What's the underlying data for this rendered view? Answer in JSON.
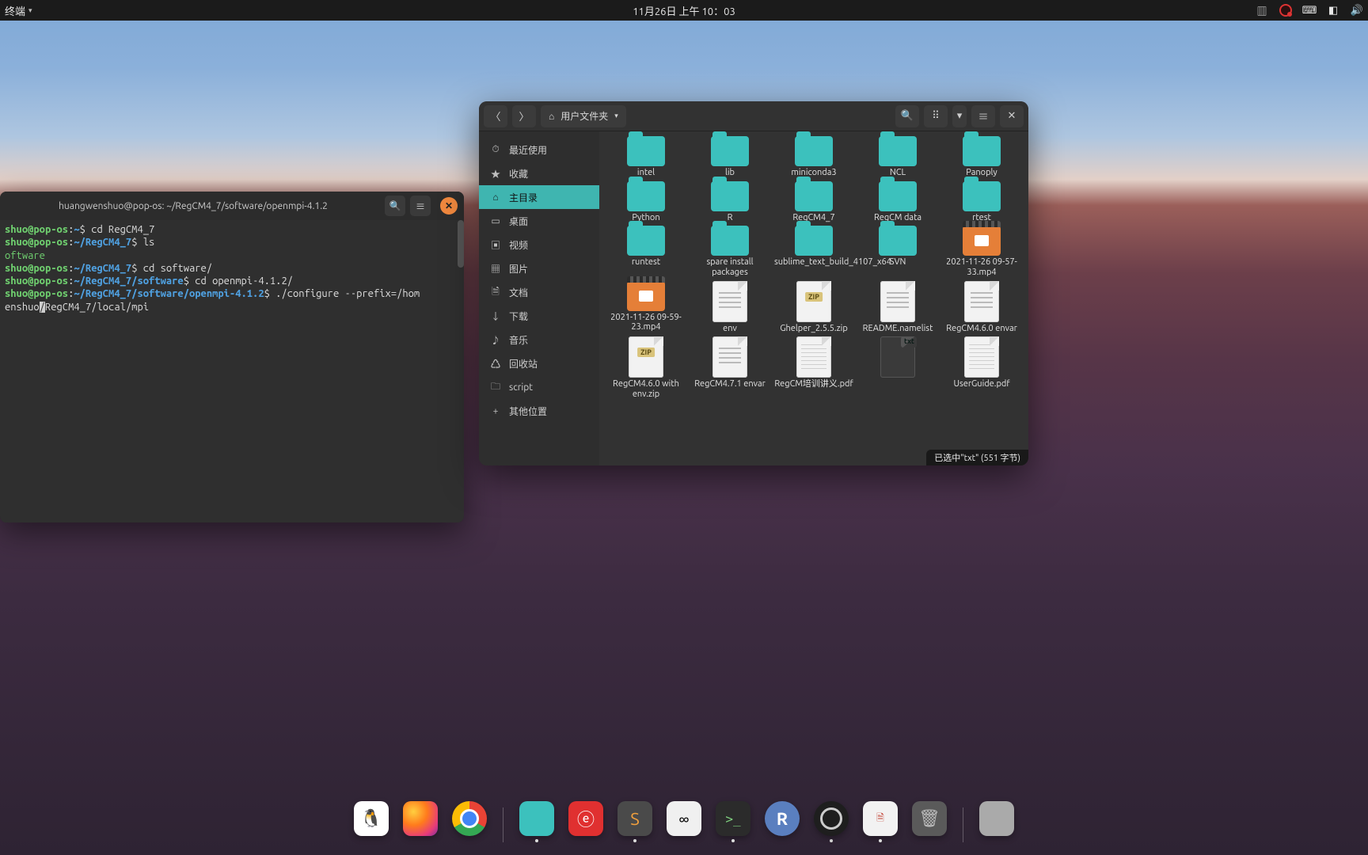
{
  "topbar": {
    "app_menu": "终端",
    "datetime": "11月26日 上午 10：03"
  },
  "terminal": {
    "title": "huangwenshuo@pop-os: ~/RegCM4_7/software/openmpi-4.1.2",
    "lines": [
      {
        "user": "shuo@pop-os",
        "sep1": ":",
        "path": "~",
        "sep2": "$",
        "cmd": " cd RegCM4_7"
      },
      {
        "user": "shuo@pop-os",
        "sep1": ":",
        "path": "~/RegCM4_7",
        "sep2": "$",
        "cmd": " ls"
      },
      {
        "out": "oftware"
      },
      {
        "user": "shuo@pop-os",
        "sep1": ":",
        "path": "~/RegCM4_7",
        "sep2": "$",
        "cmd": " cd software/"
      },
      {
        "user": "shuo@pop-os",
        "sep1": ":",
        "path": "~/RegCM4_7/software",
        "sep2": "$",
        "cmd": " cd openmpi-4.1.2/"
      },
      {
        "user": "shuo@pop-os",
        "sep1": ":",
        "path": "~/RegCM4_7/software/openmpi-4.1.2",
        "sep2": "$",
        "cmd": " ./configure --prefix=/hom"
      },
      {
        "cont_a": "enshuo",
        "cursor": "/",
        "cont_b": "RegCM4_7/local/mpi"
      }
    ]
  },
  "files": {
    "pathbar_label": "用户文件夹",
    "sidebar": [
      {
        "icon": "⏱",
        "label": "最近使用"
      },
      {
        "icon": "★",
        "label": "收藏"
      },
      {
        "icon": "⌂",
        "label": "主目录",
        "active": true
      },
      {
        "icon": "▭",
        "label": "桌面"
      },
      {
        "icon": "▣",
        "label": "视频"
      },
      {
        "icon": "▦",
        "label": "图片"
      },
      {
        "icon": "🗎",
        "label": "文档"
      },
      {
        "icon": "↓",
        "label": "下载"
      },
      {
        "icon": "♪",
        "label": "音乐"
      },
      {
        "icon": "♺",
        "label": "回收站"
      },
      {
        "icon": "🗀",
        "label": "script"
      },
      {
        "icon": "+",
        "label": "其他位置"
      }
    ],
    "items": [
      {
        "type": "folder",
        "name": "intel"
      },
      {
        "type": "folder",
        "name": "lib"
      },
      {
        "type": "folder",
        "name": "miniconda3"
      },
      {
        "type": "folder",
        "name": "NCL"
      },
      {
        "type": "folder",
        "name": "Panoply"
      },
      {
        "type": "folder",
        "name": "Python"
      },
      {
        "type": "folder",
        "name": "R"
      },
      {
        "type": "folder",
        "name": "RegCM4_7"
      },
      {
        "type": "folder",
        "name": "RegCM data"
      },
      {
        "type": "folder",
        "name": "rtest"
      },
      {
        "type": "folder",
        "name": "runtest"
      },
      {
        "type": "folder",
        "name": "spare install packages"
      },
      {
        "type": "folder",
        "name": "sublime_text_build_4107_x64"
      },
      {
        "type": "folder",
        "name": "SVN"
      },
      {
        "type": "video",
        "name": "2021-11-26 09-57-33.mp4"
      },
      {
        "type": "video",
        "name": "2021-11-26 09-59-23.mp4"
      },
      {
        "type": "text",
        "name": "env"
      },
      {
        "type": "zip",
        "name": "Ghelper_2.5.5.zip"
      },
      {
        "type": "text",
        "name": "README.namelist"
      },
      {
        "type": "text",
        "name": "RegCM4.6.0 envar"
      },
      {
        "type": "zip",
        "name": "RegCM4.6.0 with env.zip"
      },
      {
        "type": "text",
        "name": "RegCM4.7.1 envar"
      },
      {
        "type": "pdf",
        "name": "RegCM培训讲义.pdf"
      },
      {
        "type": "txt",
        "name": "",
        "selected": true
      },
      {
        "type": "pdf",
        "name": "UserGuide.pdf"
      }
    ],
    "status": "已选中\"txt\" (551 字节)"
  },
  "dock": {
    "items": [
      {
        "name": "qq",
        "cls": "penguin",
        "glyph": "🐧",
        "running": false
      },
      {
        "name": "firefox",
        "cls": "firefox",
        "glyph": "",
        "running": false
      },
      {
        "name": "chrome",
        "cls": "chrome",
        "glyph": "",
        "running": false
      },
      {
        "sep": true
      },
      {
        "name": "files",
        "cls": "folder",
        "glyph": "",
        "running": true
      },
      {
        "name": "netease",
        "cls": "netease",
        "glyph": "ⓔ",
        "running": false
      },
      {
        "name": "sublime",
        "cls": "sublime",
        "glyph": "S",
        "running": true
      },
      {
        "name": "baidu",
        "cls": "baidu",
        "glyph": "∞",
        "running": false
      },
      {
        "name": "terminal",
        "cls": "term",
        "glyph": ">_",
        "running": true
      },
      {
        "name": "rstudio",
        "cls": "rstudio",
        "glyph": "R",
        "running": false
      },
      {
        "name": "obs",
        "cls": "obs",
        "glyph": "",
        "running": true
      },
      {
        "name": "libreoffice",
        "cls": "doc",
        "glyph": "🗎",
        "running": true
      },
      {
        "name": "trash",
        "cls": "trash",
        "glyph": "🗑",
        "running": false
      },
      {
        "sep": true
      },
      {
        "name": "apps",
        "cls": "apps",
        "glyph": "",
        "running": false
      }
    ]
  }
}
